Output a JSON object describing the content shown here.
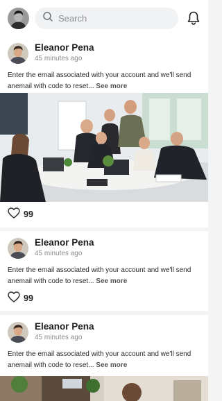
{
  "search": {
    "placeholder": "Search"
  },
  "icons": {
    "search": "search-icon",
    "notifications": "bell-icon",
    "like": "heart-icon"
  },
  "posts": [
    {
      "author": "Eleanor Pena",
      "time": "45 minutes ago",
      "text": "Enter the email associated with your account and we'll send anemail with code to reset...",
      "more_label": "See more",
      "likes": "99"
    },
    {
      "author": "Eleanor Pena",
      "time": "45 minutes ago",
      "text": "Enter the email associated with your account and we'll send anemail with code to reset...",
      "more_label": "See more",
      "likes": "99"
    },
    {
      "author": "Eleanor Pena",
      "time": "45 minutes ago",
      "text": "Enter the email associated with your account and we'll send anemail with code to reset...",
      "more_label": "See more"
    }
  ]
}
